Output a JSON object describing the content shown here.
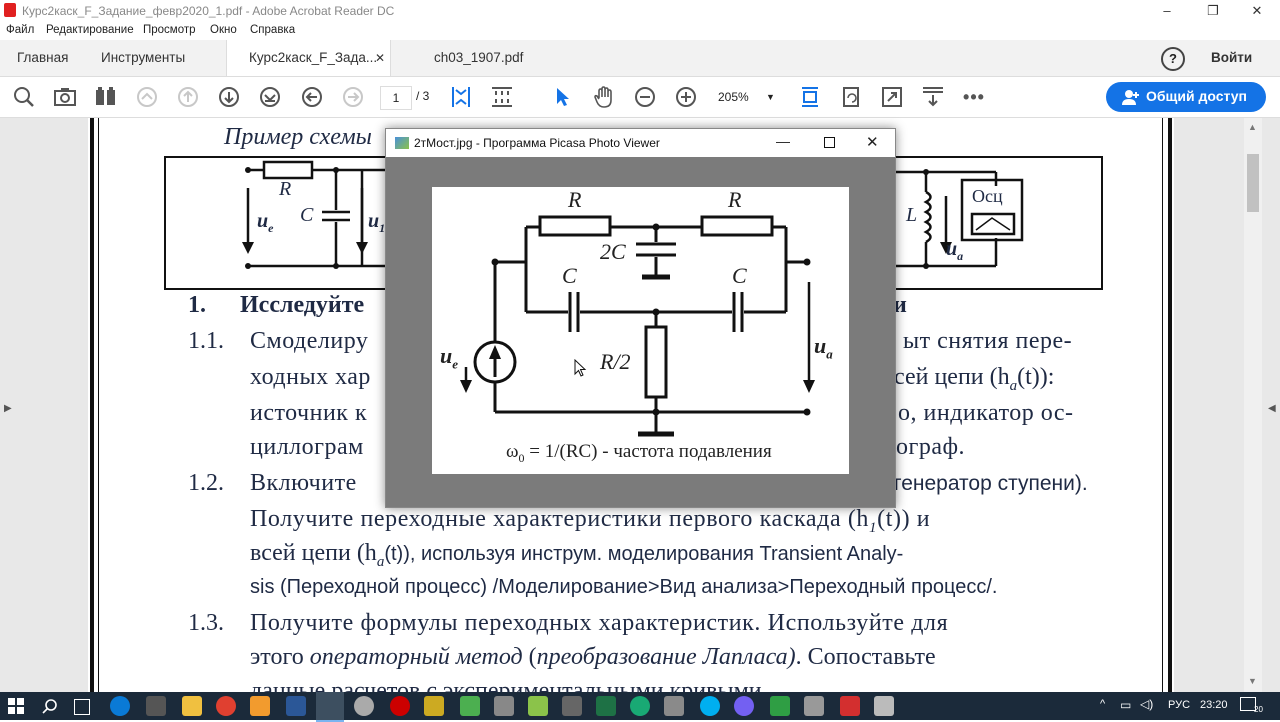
{
  "window": {
    "title": "Курс2каск_F_Задание_февр2020_1.pdf - Adobe Acrobat Reader DC",
    "controls": [
      "–",
      "❐",
      "✕"
    ]
  },
  "menu": [
    "Файл",
    "Редактирование",
    "Просмотр",
    "Окно",
    "Справка"
  ],
  "tabs": {
    "home": "Главная",
    "tools": "Инструменты",
    "doc1": "Курс2каск_F_Зада...",
    "doc1_close": "✕",
    "doc2": "ch03_1907.pdf",
    "help": "?",
    "signin": "Войти"
  },
  "toolbar": {
    "page_current": "1",
    "page_total": "/ 3",
    "zoom": "205%",
    "share": "Общий доступ"
  },
  "document": {
    "caption": "Пример схемы",
    "figure_labels": {
      "R": "R",
      "C": "C",
      "ue": "u",
      "ue_sub": "e",
      "u1": "u",
      "u1_sub": "1",
      "L": "L",
      "osc": "Осц",
      "ua": "u",
      "ua_sub": "a"
    },
    "heading_num": "1.",
    "heading": "Исследуйте",
    "heading_tail": "и",
    "items": [
      {
        "num": "1.1.",
        "lines": [
          "Смоделиру",
          "ыт снятия пере-",
          "ходных хар",
          "сей цепи (h",
          "a",
          "(t)):",
          "источник к",
          "о, индикатор ос-",
          "циллограм",
          "ограф."
        ]
      },
      {
        "num": "1.2.",
        "lines": [
          "Включите",
          "генератор ступени).",
          "Получите переходные характеристики первого каскада (h",
          "1",
          "(t)) и",
          "всей цепи (h",
          "a",
          "(t)), используя инструм. моделирования Transient Analy-",
          "sis (Переходной процесс) /Моделирование>Вид анализа>Переходный процесс/."
        ]
      },
      {
        "num": "1.3.",
        "lines": [
          "Получите формулы переходных характеристик. Используйте для",
          "этого ",
          "операторный метод",
          " (",
          "преобразование Лапласа)",
          ". Сопоставьте",
          "данные расчетов с экспериментальными кривыми"
        ]
      }
    ]
  },
  "picasa": {
    "title": "2тМост.jpg - Программа Picasa Photo Viewer",
    "labels": {
      "R1": "R",
      "R2": "R",
      "C2": "2C",
      "C_left": "C",
      "C_right": "C",
      "R_half": "R/2",
      "ue": "u",
      "ue_sub": "e",
      "ua": "u",
      "ua_sub": "a",
      "formula": "ω",
      "formula_sub": "0",
      "formula_rest": " = 1/(RC) - частота подавления"
    }
  },
  "taskbar": {
    "lang": "РУС",
    "time": "23:20",
    "date": "20"
  },
  "colors": {
    "accent": "#1473e6",
    "doc_text": "#1f2a44",
    "picasa_bg": "#7b7b7b",
    "taskbar": "#1b2a3a"
  }
}
